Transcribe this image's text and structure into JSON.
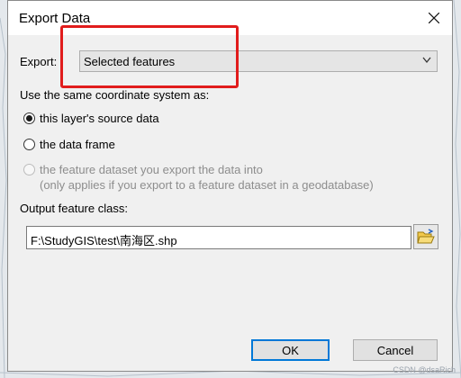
{
  "dialog": {
    "title": "Export Data",
    "export_label": "Export:",
    "export_value": "Selected features",
    "coord_heading": "Use the same coordinate system as:",
    "radio_source": "this layer's source data",
    "radio_frame": "the data frame",
    "radio_dataset": "the feature dataset you export the data into",
    "radio_dataset_note": "(only applies if you export to a feature dataset in a geodatabase)",
    "output_label": "Output feature class:",
    "output_value": "F:\\StudyGIS\\test\\南海区.shp",
    "ok_label": "OK",
    "cancel_label": "Cancel"
  },
  "watermark": "CSDN @dsaRich",
  "colors": {
    "highlight": "#e11c1c",
    "ok_border": "#0078d7",
    "dialog_bg": "#f0f0f0"
  },
  "icons": [
    "close-icon",
    "chevron-down-icon",
    "open-folder-icon"
  ]
}
